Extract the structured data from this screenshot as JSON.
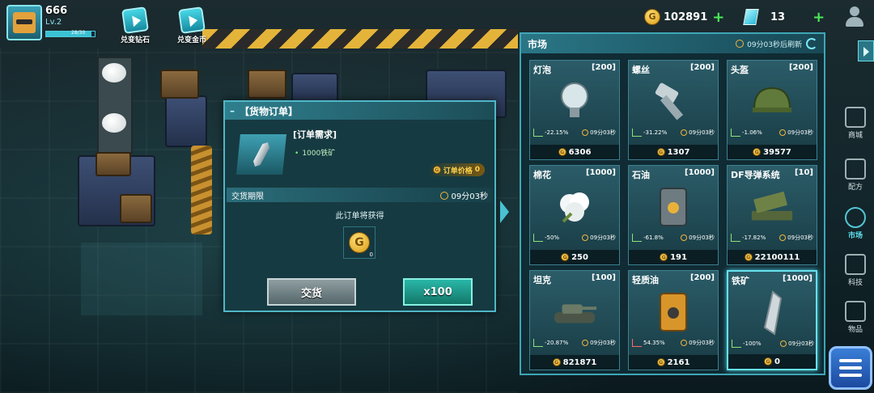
{
  "player": {
    "name": "666",
    "level": "Lv.2",
    "xp_text": "28/30",
    "xp_progress": 0.93
  },
  "top_buttons": [
    {
      "label": "兑变钻石",
      "icon": "video-play-icon"
    },
    {
      "label": "兑变金币",
      "icon": "video-play-icon"
    }
  ],
  "currency": {
    "gold": "102891",
    "gems": "13"
  },
  "order": {
    "title": "【货物订单】",
    "req_title": "[订单需求]",
    "req_item": "1000铁矿",
    "price_label": "订单价格",
    "price_value": "0",
    "deadline_label": "交货期限",
    "deadline_time": "09分03秒",
    "earn_text": "此订单将获得",
    "reward_qty": "0",
    "deliver_label": "交货",
    "multiplier_label": "x100"
  },
  "market": {
    "title": "市场",
    "refresh_text": "09分03秒后刷新",
    "items": [
      {
        "name": "灯泡",
        "count": "[200]",
        "trend": "-22.15%",
        "up": false,
        "time": "09分03秒",
        "price": "6306",
        "icon": "lightbulb-icon"
      },
      {
        "name": "螺丝",
        "count": "[200]",
        "trend": "-31.22%",
        "up": false,
        "time": "09分03秒",
        "price": "1307",
        "icon": "screw-icon"
      },
      {
        "name": "头盔",
        "count": "[200]",
        "trend": "-1.06%",
        "up": false,
        "time": "09分03秒",
        "price": "39577",
        "icon": "helmet-icon"
      },
      {
        "name": "棉花",
        "count": "[1000]",
        "trend": "-50%",
        "up": false,
        "time": "09分03秒",
        "price": "250",
        "icon": "cotton-icon"
      },
      {
        "name": "石油",
        "count": "[1000]",
        "trend": "-61.8%",
        "up": false,
        "time": "09分03秒",
        "price": "191",
        "icon": "oil-barrel-icon"
      },
      {
        "name": "DF导弹系统",
        "count": "[10]",
        "trend": "-17.82%",
        "up": false,
        "time": "09分03秒",
        "price": "22100111",
        "icon": "missile-launcher-icon"
      },
      {
        "name": "坦克",
        "count": "[100]",
        "trend": "-20.87%",
        "up": false,
        "time": "09分03秒",
        "price": "821871",
        "icon": "tank-icon"
      },
      {
        "name": "轻质油",
        "count": "[200]",
        "trend": "54.35%",
        "up": true,
        "time": "09分03秒",
        "price": "2161",
        "icon": "light-oil-barrel-icon"
      },
      {
        "name": "铁矿",
        "count": "[1000]",
        "trend": "-100%",
        "up": false,
        "time": "09分03秒",
        "price": "0",
        "icon": "iron-ore-icon",
        "selected": true
      }
    ]
  },
  "nav": [
    {
      "label": "商城",
      "icon": "cart-icon"
    },
    {
      "label": "配方",
      "icon": "recipe-icon"
    },
    {
      "label": "市场",
      "icon": "market-icon",
      "active": true
    },
    {
      "label": "科技",
      "icon": "tech-icon"
    },
    {
      "label": "物品",
      "icon": "items-icon"
    }
  ],
  "colors": {
    "accent": "#4fd2e2",
    "gold": "#ffd24a",
    "down": "#8fe27a",
    "up": "#ff6a6a"
  }
}
